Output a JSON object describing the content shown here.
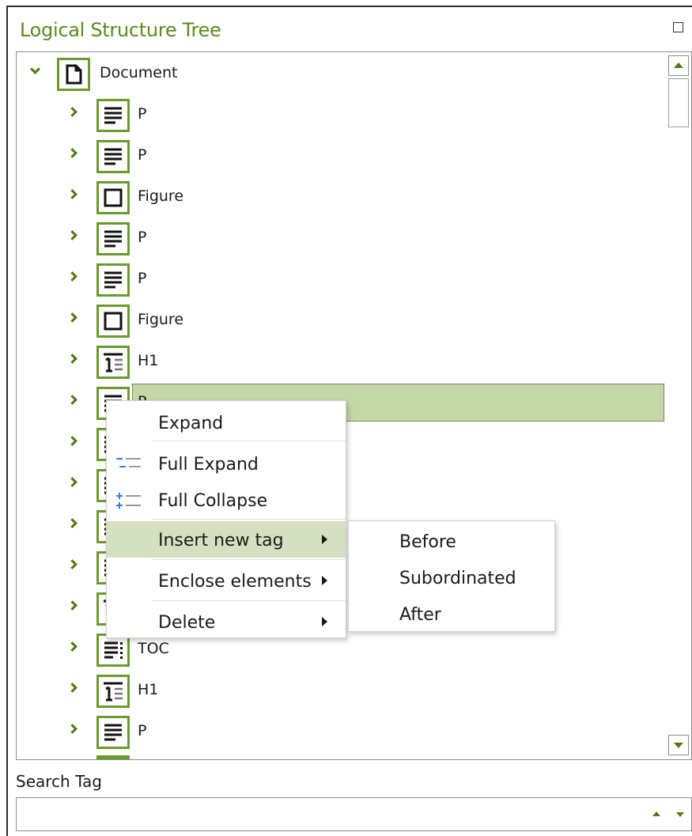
{
  "panel": {
    "title": "Logical Structure Tree"
  },
  "tree": {
    "root": {
      "label": "Document",
      "icon": "document-icon",
      "expanded": true
    },
    "children": [
      {
        "label": "P",
        "icon": "paragraph-tag-icon"
      },
      {
        "label": "P",
        "icon": "paragraph-tag-icon"
      },
      {
        "label": "Figure",
        "icon": "figure-tag-icon"
      },
      {
        "label": "P",
        "icon": "paragraph-tag-icon"
      },
      {
        "label": "P",
        "icon": "paragraph-tag-icon"
      },
      {
        "label": "Figure",
        "icon": "figure-tag-icon"
      },
      {
        "label": "H1",
        "icon": "heading-tag-icon"
      },
      {
        "label": "P",
        "icon": "paragraph-tag-icon",
        "selected": true
      },
      {
        "label": "",
        "icon": "paragraph-tag-icon"
      },
      {
        "label": "",
        "icon": "list-tag-icon"
      },
      {
        "label": "",
        "icon": "paragraph-tag-icon"
      },
      {
        "label": "",
        "icon": "paragraph-tag-icon"
      },
      {
        "label": "",
        "icon": "heading-tag-icon"
      },
      {
        "label": "TOC",
        "icon": "toc-tag-icon"
      },
      {
        "label": "H1",
        "icon": "heading-tag-icon"
      },
      {
        "label": "P",
        "icon": "paragraph-tag-icon"
      }
    ]
  },
  "context_menu": {
    "items": [
      {
        "label": "Expand"
      },
      {
        "label": "Full Expand",
        "icon": "full-expand-icon"
      },
      {
        "label": "Full Collapse",
        "icon": "full-collapse-icon"
      },
      {
        "label": "Insert new tag",
        "has_submenu": true,
        "highlighted": true
      },
      {
        "label": "Enclose elements",
        "has_submenu": true
      },
      {
        "label": "Delete",
        "has_submenu": true
      }
    ]
  },
  "submenu": {
    "items": [
      "Before",
      "Subordinated",
      "After"
    ]
  },
  "search": {
    "label": "Search Tag",
    "value": "",
    "placeholder": ""
  },
  "colors": {
    "accent_green": "#6b9a2e",
    "title_green": "#5b8a1e",
    "selection": "#c5d7a6",
    "menu_highlight": "#d4e0c0"
  }
}
